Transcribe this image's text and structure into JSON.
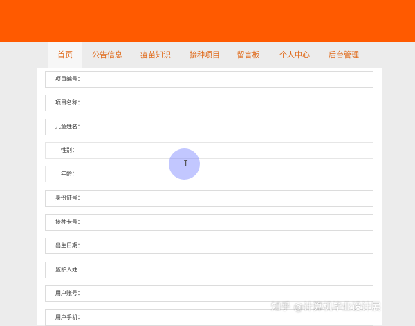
{
  "nav": {
    "items": [
      "首页",
      "公告信息",
      "疫苗知识",
      "接种项目",
      "留言板",
      "个人中心",
      "后台管理"
    ]
  },
  "form": {
    "fields": [
      {
        "label": "项目编号："
      },
      {
        "label": "项目名称："
      },
      {
        "label": "儿童姓名："
      },
      {
        "label": "性别："
      },
      {
        "label": "年龄："
      },
      {
        "label": "身份证号："
      },
      {
        "label": "接种卡号："
      },
      {
        "label": "出生日期："
      },
      {
        "label": "监护人姓..."
      },
      {
        "label": "用户账号："
      },
      {
        "label": "用户手机："
      }
    ]
  },
  "watermark": "知乎 @计算机毕业设计展",
  "colors": {
    "brand": "#ff5a00",
    "nav_text": "#e06a1a"
  }
}
